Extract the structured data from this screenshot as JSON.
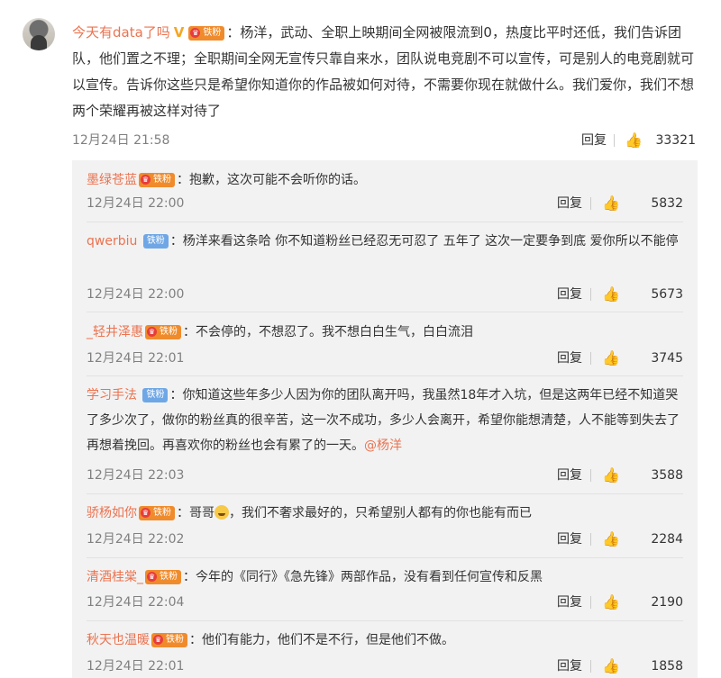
{
  "main": {
    "author": "今天有data了吗",
    "text": "：杨洋，武动、全职上映期间全网被限流到0，热度比平时还低，我们告诉团队，他们置之不理；全职期间全网无宣传只靠自来水，团队说电竞剧不可以宣传，可是别人的电竞剧就可以宣传。告诉你这些只是希望你知道你的作品被如何对待，不需要你现在就做什么。我们爱你，我们不想两个荣耀再被这样对待了",
    "time": "12月24日 21:58",
    "reply_label": "回复",
    "likes": "33321",
    "badge": "V",
    "fan_label": "铁粉"
  },
  "replies": [
    {
      "user": "墨绿苍蓝",
      "fan": "铁粉",
      "fan_style": "orange",
      "text": "：抱歉，这次可能不会听你的话。",
      "time": "12月24日 22:00",
      "reply_label": "回复",
      "likes": "5832"
    },
    {
      "user": "qwerbiu",
      "fan": "铁粉",
      "fan_style": "blue",
      "text": "：杨洋来看这条哈 你不知道粉丝已经忍无可忍了 五年了 这次一定要争到底 爱你所以不能停",
      "time": "12月24日 22:00",
      "reply_label": "回复",
      "likes": "5673"
    },
    {
      "user": "_轻井泽惠",
      "fan": "铁粉",
      "fan_style": "orange",
      "text": "：不会停的，不想忍了。我不想白白生气，白白流泪",
      "time": "12月24日 22:01",
      "reply_label": "回复",
      "likes": "3745"
    },
    {
      "user": "学习手法",
      "fan": "铁粉",
      "fan_style": "blue",
      "text": "：你知道这些年多少人因为你的团队离开吗，我虽然18年才入坑，但是这两年已经不知道哭了多少次了，做你的粉丝真的很辛苦，这一次不成功，多少人会离开，希望你能想清楚，人不能等到失去了再想着挽回。再喜欢你的粉丝也会有累了的一天。",
      "mention": "@杨洋",
      "time": "12月24日 22:03",
      "reply_label": "回复",
      "likes": "3588"
    },
    {
      "user": "骄杨如你",
      "fan": "铁粉",
      "fan_style": "orange",
      "text_before": "：哥哥",
      "text_after": "，我们不奢求最好的，只希望别人都有的你也能有而已",
      "time": "12月24日 22:02",
      "reply_label": "回复",
      "likes": "2284"
    },
    {
      "user": "清酒桂棠_",
      "fan": "铁粉",
      "fan_style": "orange",
      "text": "：今年的《同行》《急先锋》两部作品，没有看到任何宣传和反黑",
      "time": "12月24日 22:04",
      "reply_label": "回复",
      "likes": "2190"
    },
    {
      "user": "秋天也温暖",
      "fan": "铁粉",
      "fan_style": "orange",
      "text": "：他们有能力，他们不是不行，但是他们不做。",
      "time": "12月24日 22:01",
      "reply_label": "回复",
      "likes": "1858"
    }
  ]
}
